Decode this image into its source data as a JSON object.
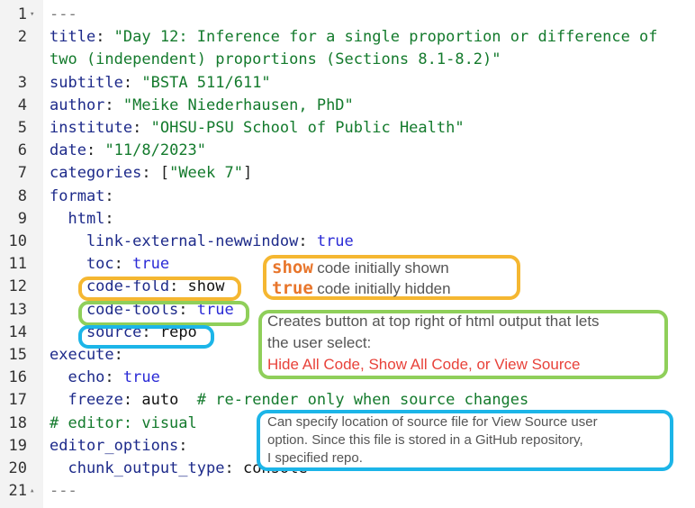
{
  "editor": {
    "lines": [
      {
        "n": "1",
        "fold": "▾",
        "parts": [
          {
            "t": "---",
            "c": "dash"
          }
        ]
      },
      {
        "n": "2",
        "parts": [
          {
            "t": "title",
            "c": "k"
          },
          {
            "t": ": ",
            "c": "p"
          },
          {
            "t": "\"Day 12: Inference for a single proportion or difference of",
            "c": "s"
          }
        ]
      },
      {
        "n": "",
        "parts": [
          {
            "t": "two (independent) proportions (Sections 8.1-8.2)\"",
            "c": "s"
          }
        ]
      },
      {
        "n": "3",
        "parts": [
          {
            "t": "subtitle",
            "c": "k"
          },
          {
            "t": ": ",
            "c": "p"
          },
          {
            "t": "\"BSTA 511/611\"",
            "c": "s"
          }
        ]
      },
      {
        "n": "4",
        "parts": [
          {
            "t": "author",
            "c": "k"
          },
          {
            "t": ": ",
            "c": "p"
          },
          {
            "t": "\"Meike Niederhausen, PhD\"",
            "c": "s"
          }
        ]
      },
      {
        "n": "5",
        "parts": [
          {
            "t": "institute",
            "c": "k"
          },
          {
            "t": ": ",
            "c": "p"
          },
          {
            "t": "\"OHSU-PSU School of Public Health\"",
            "c": "s"
          }
        ]
      },
      {
        "n": "6",
        "parts": [
          {
            "t": "date",
            "c": "k"
          },
          {
            "t": ": ",
            "c": "p"
          },
          {
            "t": "\"11/8/2023\"",
            "c": "s"
          }
        ]
      },
      {
        "n": "7",
        "parts": [
          {
            "t": "categories",
            "c": "k"
          },
          {
            "t": ": [",
            "c": "p"
          },
          {
            "t": "\"Week 7\"",
            "c": "s"
          },
          {
            "t": "]",
            "c": "p"
          }
        ]
      },
      {
        "n": "8",
        "parts": [
          {
            "t": "format",
            "c": "k"
          },
          {
            "t": ":",
            "c": "p"
          }
        ]
      },
      {
        "n": "9",
        "parts": [
          {
            "t": "  html",
            "c": "k"
          },
          {
            "t": ":",
            "c": "p"
          }
        ]
      },
      {
        "n": "10",
        "parts": [
          {
            "t": "    link-external-newwindow",
            "c": "k"
          },
          {
            "t": ": ",
            "c": "p"
          },
          {
            "t": "true",
            "c": "b"
          }
        ]
      },
      {
        "n": "11",
        "parts": [
          {
            "t": "    toc",
            "c": "k"
          },
          {
            "t": ": ",
            "c": "p"
          },
          {
            "t": "true",
            "c": "b"
          }
        ]
      },
      {
        "n": "12",
        "parts": [
          {
            "t": "    code-fold",
            "c": "k"
          },
          {
            "t": ": ",
            "c": "p"
          },
          {
            "t": "show",
            "c": "v"
          }
        ]
      },
      {
        "n": "13",
        "parts": [
          {
            "t": "    code-tools",
            "c": "k"
          },
          {
            "t": ": ",
            "c": "p"
          },
          {
            "t": "true",
            "c": "b"
          }
        ]
      },
      {
        "n": "14",
        "parts": [
          {
            "t": "    source",
            "c": "k"
          },
          {
            "t": ": ",
            "c": "p"
          },
          {
            "t": "repo",
            "c": "v"
          }
        ]
      },
      {
        "n": "15",
        "parts": [
          {
            "t": "execute",
            "c": "k"
          },
          {
            "t": ":",
            "c": "p"
          }
        ]
      },
      {
        "n": "16",
        "parts": [
          {
            "t": "  echo",
            "c": "k"
          },
          {
            "t": ": ",
            "c": "p"
          },
          {
            "t": "true",
            "c": "b"
          }
        ]
      },
      {
        "n": "17",
        "parts": [
          {
            "t": "  freeze",
            "c": "k"
          },
          {
            "t": ": ",
            "c": "p"
          },
          {
            "t": "auto",
            "c": "v"
          },
          {
            "t": "  # re-render only when source changes",
            "c": "c"
          }
        ]
      },
      {
        "n": "18",
        "parts": [
          {
            "t": "# editor: visual",
            "c": "c"
          }
        ]
      },
      {
        "n": "19",
        "parts": [
          {
            "t": "editor_options",
            "c": "k"
          },
          {
            "t": ":",
            "c": "p"
          }
        ]
      },
      {
        "n": "20",
        "parts": [
          {
            "t": "  chunk_output_type",
            "c": "k"
          },
          {
            "t": ": ",
            "c": "p"
          },
          {
            "t": "console",
            "c": "v"
          }
        ]
      },
      {
        "n": "21",
        "fold": "▴",
        "parts": [
          {
            "t": "---",
            "c": "dash"
          }
        ]
      }
    ]
  },
  "annotations": {
    "fold_note": {
      "show_kw": "show",
      "show_text": "code initially shown",
      "true_kw": "true",
      "true_text": "code initially hidden"
    },
    "tools_note": {
      "line1": "Creates button at top right of html output that lets",
      "line2": "the user select:",
      "line3": "Hide All Code, Show All Code, or View Source"
    },
    "source_note": {
      "line1": "Can specify location of source file for View Source user",
      "line2": "option. Since this file is stored in a GitHub repository,",
      "line3": "I specified repo."
    },
    "colors": {
      "orange": "#f5b731",
      "green": "#8fcf5a",
      "blue": "#1cb5e8",
      "red_text": "#e8423a",
      "keyword_orange": "#e8762c"
    }
  }
}
